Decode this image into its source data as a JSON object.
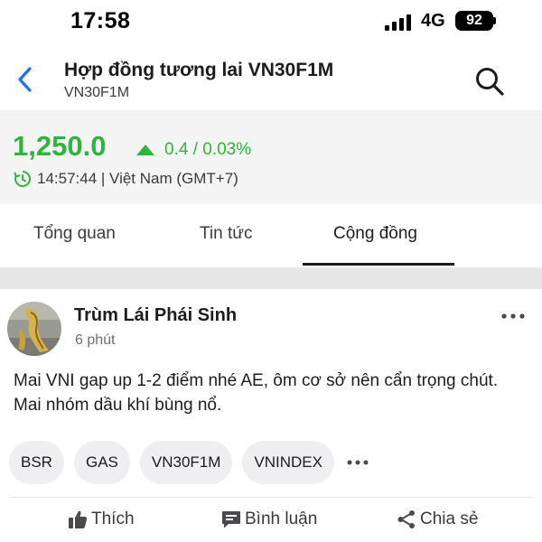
{
  "status_bar": {
    "time": "17:58",
    "network": "4G",
    "battery": "92"
  },
  "header": {
    "title": "Hợp đồng tương lai VN30F1M",
    "subtitle": "VN30F1M"
  },
  "quote": {
    "price": "1,250.0",
    "change": "0.4 / 0.03%",
    "timestamp": "14:57:44 | Việt Nam (GMT+7)",
    "up_color": "#2fb43c"
  },
  "tabs": [
    {
      "label": "Tổng quan",
      "active": false
    },
    {
      "label": "Tin tức",
      "active": false
    },
    {
      "label": "Cộng đồng",
      "active": true
    }
  ],
  "post": {
    "author": "Trùm Lái Phái Sinh",
    "time": "6 phút",
    "content": "Mai VNI gap up 1-2 điểm nhé AE, ôm cơ sở nên cẩn trọng chút. Mai nhóm dầu khí bùng nổ.",
    "tags": [
      "BSR",
      "GAS",
      "VN30F1M",
      "VNINDEX"
    ],
    "actions": {
      "like": "Thích",
      "comment": "Bình luận",
      "share": "Chia sẻ"
    }
  },
  "icons": [
    "back-chevron-icon",
    "search-icon",
    "clock-icon",
    "up-triangle-icon",
    "more-icon",
    "thumbs-up-icon",
    "comment-icon",
    "share-icon"
  ]
}
